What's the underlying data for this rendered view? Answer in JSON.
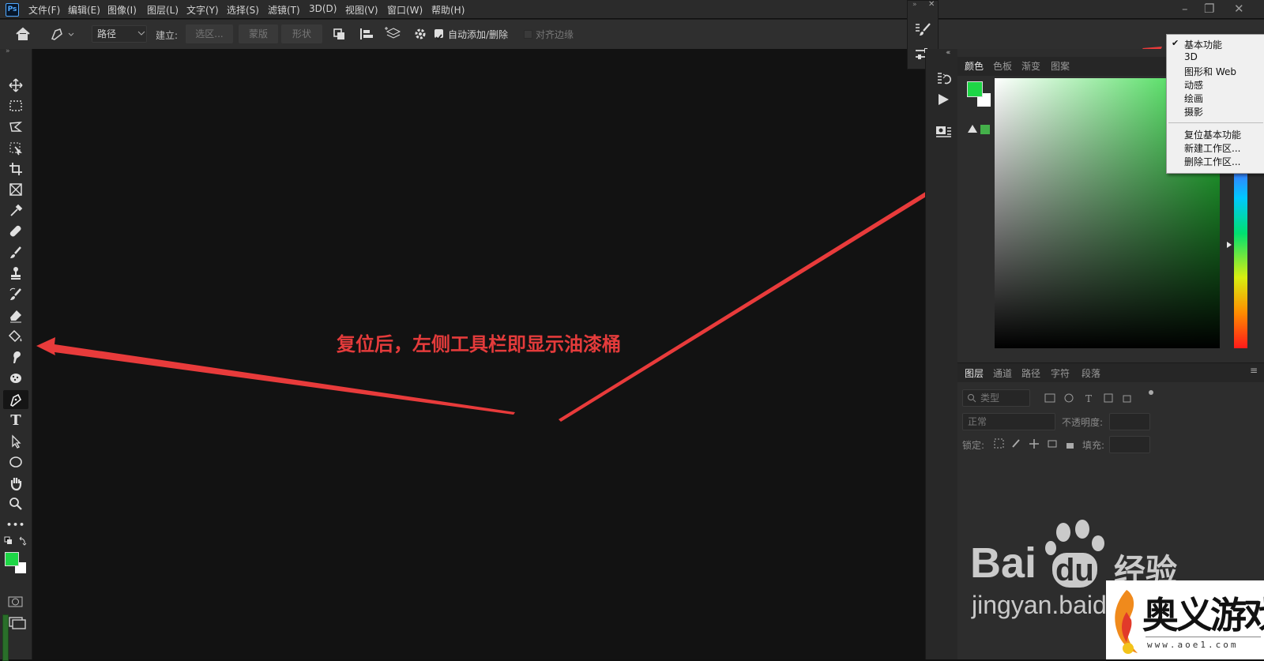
{
  "app": {
    "logo_text": "Ps"
  },
  "menubar": {
    "items": [
      "文件(F)",
      "编辑(E)",
      "图像(I)",
      "图层(L)",
      "文字(Y)",
      "选择(S)",
      "滤镜(T)",
      "3D(D)",
      "视图(V)",
      "窗口(W)",
      "帮助(H)"
    ]
  },
  "options_bar": {
    "mode_select": "路径",
    "make_label": "建立:",
    "selection_button": "选区...",
    "mask_button": "蒙版",
    "shape_button": "形状",
    "auto_add_delete_label": "自动添加/删除",
    "auto_add_delete_checked": true,
    "align_edges_label": "对齐边缘",
    "align_edges_checked": false
  },
  "toolbar": {
    "tools": [
      "move-tool",
      "marquee-tool",
      "lasso-tool",
      "object-select-tool",
      "crop-tool",
      "frame-tool",
      "eyedropper-tool",
      "healing-tool",
      "brush-tool",
      "stamp-tool",
      "history-brush-tool",
      "eraser-tool",
      "paint-bucket-tool",
      "smudge-tool",
      "sponge-tool",
      "pen-tool",
      "type-tool",
      "path-select-tool",
      "ellipse-tool",
      "hand-tool",
      "zoom-tool",
      "more-tools"
    ],
    "type_glyph": "T",
    "more_glyph": "•••",
    "selected_tool": "pen-tool",
    "foreground_color": "#1ed646",
    "background_color": "#ffffff"
  },
  "annotation": {
    "text": "复位后，左侧工具栏即显示油漆桶",
    "color": "#e43b3b"
  },
  "color_panel": {
    "tabs": [
      "颜色",
      "色板",
      "渐变",
      "图案"
    ],
    "active_tab": "颜色",
    "foreground_color": "#1ed646",
    "background_color": "#ffffff",
    "gamut_warning_color": "#44b04a"
  },
  "layers_panel": {
    "tabs": [
      "图层",
      "通道",
      "路径",
      "字符",
      "段落"
    ],
    "active_tab": "图层",
    "filter_placeholder": "类型",
    "blend_mode": "正常",
    "opacity_label": "不透明度:",
    "lock_label": "锁定:",
    "fill_label": "填充:"
  },
  "workspace_menu": {
    "items": [
      "基本功能",
      "3D",
      "图形和 Web",
      "动感",
      "绘画",
      "摄影"
    ],
    "checked": "基本功能",
    "check_mark": "✔",
    "actions": [
      "复位基本功能",
      "新建工作区...",
      "删除工作区..."
    ]
  },
  "watermarks": {
    "baidu_brand": "Bai",
    "baidu_du": "du",
    "baidu_cn": "经验",
    "baidu_url": "jingyan.baidu.com",
    "site_name": "奥义游戏网",
    "site_url": "www.aoe1.com"
  }
}
